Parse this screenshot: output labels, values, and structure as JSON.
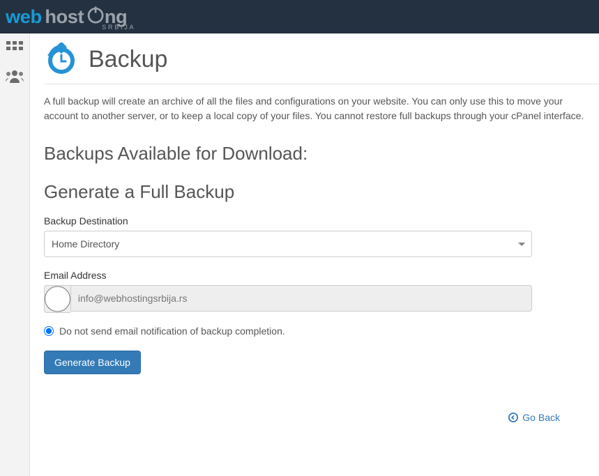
{
  "brand": {
    "text_web": "web",
    "text_host": "host",
    "text_ng": "ng",
    "sub": "SRBIJA"
  },
  "page": {
    "title": "Backup",
    "intro": "A full backup will create an archive of all the files and configurations on your website. You can only use this to move your account to another server, or to keep a local copy of your files. You cannot restore full backups through your cPanel interface."
  },
  "sections": {
    "available": "Backups Available for Download:",
    "generate": "Generate a Full Backup"
  },
  "form": {
    "destination_label": "Backup Destination",
    "destination_value": "Home Directory",
    "email_label": "Email Address",
    "email_value": "info@webhostingsrbija.rs",
    "no_email_label": "Do not send email notification of backup completion.",
    "submit": "Generate Backup"
  },
  "footer": {
    "go_back": "Go Back"
  }
}
